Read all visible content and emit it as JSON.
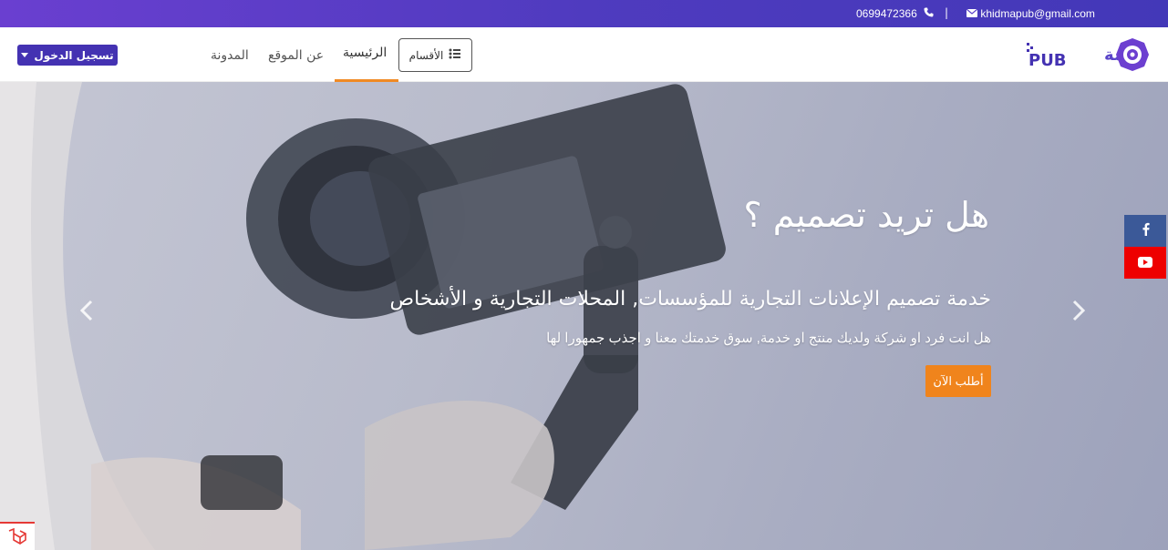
{
  "topbar": {
    "email": "khidmapub@gmail.com",
    "separator": "|",
    "phone": "0699472366",
    "email_icon": "envelope-icon",
    "phone_icon": "phone-icon"
  },
  "navbar": {
    "login_label": "تسجيل الدخول",
    "links": {
      "blog": "المدونة",
      "about": "عن الموقع",
      "home": "الرئيسية"
    },
    "sections_label": "الأقسام",
    "logo": {
      "text_ar": "خدمة",
      "text_en": "PUB"
    },
    "accent_color": "#f08a24",
    "brand_color": "#4432b2"
  },
  "hero": {
    "title": "هل تريد تصميم ؟",
    "subtitle": "خدمة تصميم الإعلانات التجارية للمؤسسات, المحلات التجارية و الأشخاص",
    "text": "هل انت فرد او شركة ولديك منتج او خدمة, سوق خدمتك معنا و اجذب جمهورا لها",
    "cta_label": "أطلب الآن",
    "cta_color": "#f0841c"
  },
  "social": {
    "facebook_icon": "facebook-icon",
    "youtube_icon": "youtube-icon"
  }
}
